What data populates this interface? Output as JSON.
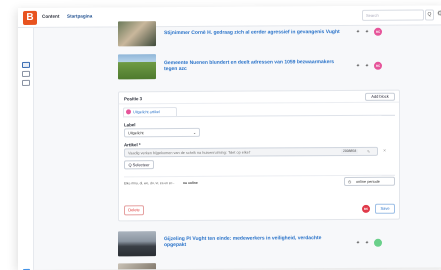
{
  "app": {
    "logo_letter": "B",
    "nav": [
      "Content",
      "Startpagina"
    ],
    "search_placeholder": "Search",
    "search_button": "Q"
  },
  "articles_top": [
    {
      "title": "Stijnimmer Cornè H. gedraag zich al eerder agressief in gevangenis Vught",
      "avatar": "RC",
      "avatar_color": "#e6559a"
    },
    {
      "title": "Gemeente Nuenen blundert en deelt adressen van 1059 bezwaarmakers tegen azc",
      "avatar": "RC",
      "avatar_color": "#e6559a"
    }
  ],
  "position_card": {
    "header": "Positie 3",
    "add_block": "Add block",
    "tab_label": "Uitgelicht artikel",
    "label_heading": "Label",
    "label_value": "Uitgelicht",
    "article_heading": "Artikel *",
    "article_value": "Vaadig verken bijgekomen van de schrik na huisenruiming: 'Niet op elkel'",
    "article_chip": "2008858",
    "select_button": "Q Selecteer",
    "dates_text": "Elke mnu, di, wo, do, vr, za en zo -",
    "dates_status": "nu online",
    "online_period": "online periode",
    "delete_button": "Delete",
    "save_button": "Save",
    "footer_avatar": "BK",
    "footer_avatar_color": "#e03a4a"
  },
  "articles_bottom": [
    {
      "title": "Gijzeling PI Vught ten einde: medewerkers in veiligheid, verdachte opgepakt",
      "avatar": "",
      "avatar_color": "#6ad08a"
    }
  ],
  "colors": {
    "accent": "#e8531f",
    "link": "#2a73c9"
  }
}
